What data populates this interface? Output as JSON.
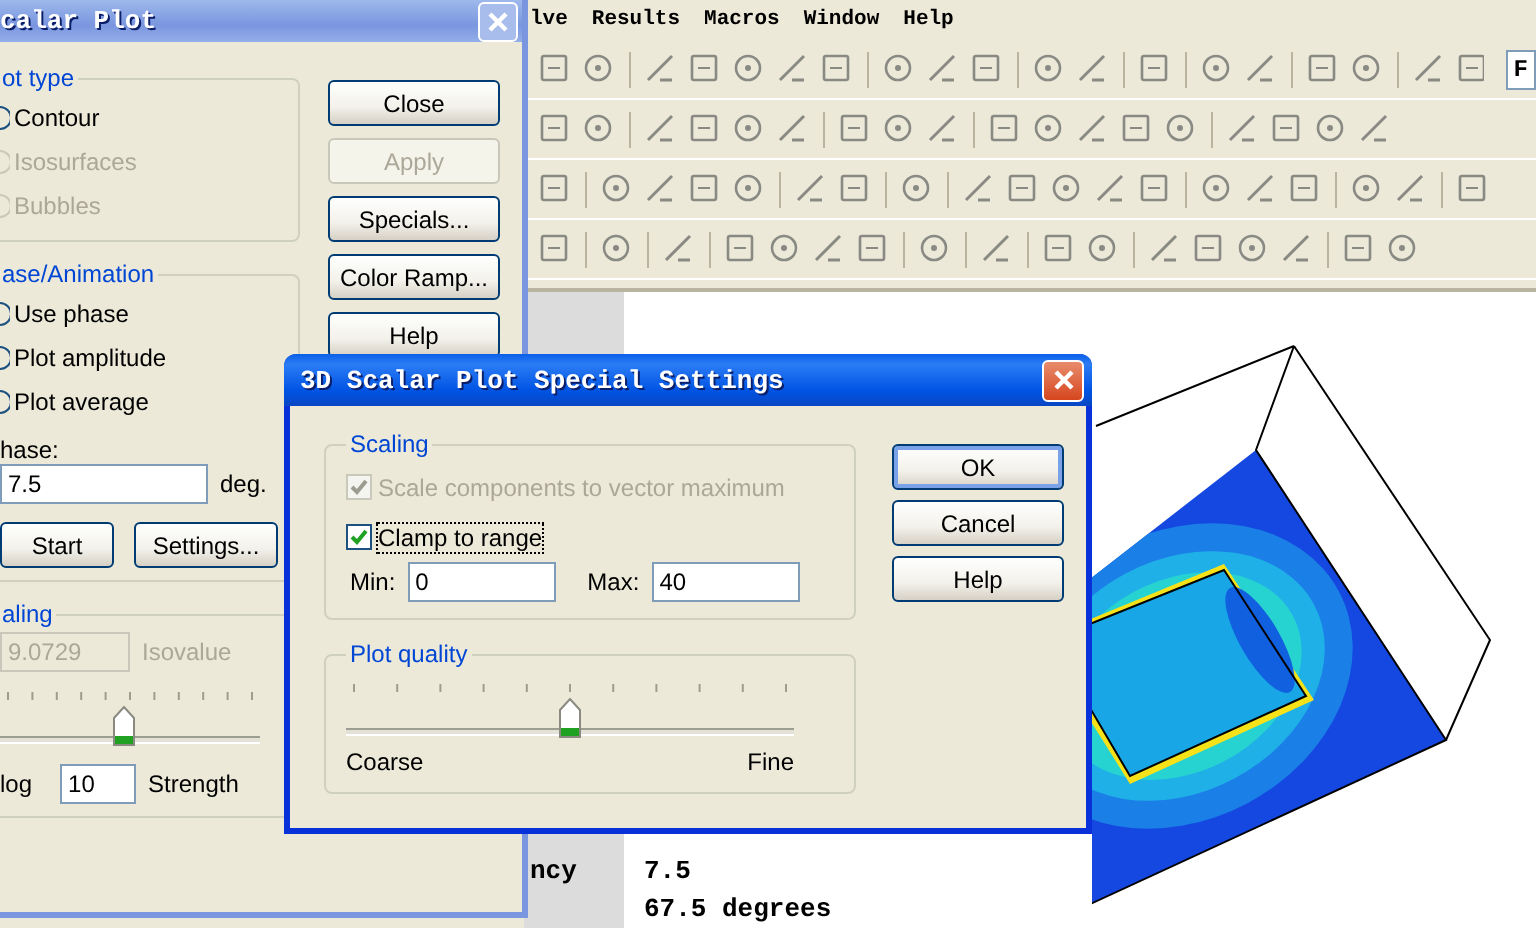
{
  "background_app": {
    "menu": [
      {
        "label": "lve"
      },
      {
        "label": "Results"
      },
      {
        "label": "Macros"
      },
      {
        "label": "Window"
      },
      {
        "label": "Help"
      }
    ],
    "toolbar_field": "F",
    "info_rows": [
      {
        "label": "ncy",
        "value": "7.5"
      },
      {
        "value": "67.5 degrees"
      }
    ]
  },
  "scalar_plot_dialog": {
    "title": "calar Plot",
    "plot_type": {
      "legend": "ot type",
      "options": [
        {
          "label": "Contour",
          "disabled": false
        },
        {
          "label": "Isosurfaces",
          "disabled": true
        },
        {
          "label": "Bubbles",
          "disabled": true
        }
      ]
    },
    "buttons": [
      {
        "label": "Close",
        "disabled": false
      },
      {
        "label": "Apply",
        "disabled": true
      },
      {
        "label": "Specials...",
        "disabled": false
      },
      {
        "label": "Color Ramp...",
        "disabled": false
      },
      {
        "label": "Help",
        "disabled": false
      }
    ],
    "phase_animation": {
      "legend": "ase/Animation",
      "options": [
        {
          "label": "Use phase",
          "disabled": false
        },
        {
          "label": "Plot amplitude",
          "disabled": false
        },
        {
          "label": "Plot average",
          "disabled": false
        }
      ],
      "phase_label": "hase:",
      "phase_value": "7.5",
      "phase_unit": "deg.",
      "buttons": [
        "Start",
        "Settings..."
      ]
    },
    "scaling": {
      "legend": "aling",
      "isovalue": "9.0729",
      "isovalue_disabled": true,
      "isovalue_label": "Isovalue",
      "slider": {
        "level": 0.48
      },
      "log_label": "log",
      "strength_value": "10",
      "strength_label": "Strength"
    }
  },
  "special_settings_dialog": {
    "title": "3D Scalar Plot Special Settings",
    "scaling": {
      "legend": "Scaling",
      "checkboxes": [
        {
          "label": "Scale components to vector maximum",
          "checked": true,
          "disabled": true,
          "focused": false
        },
        {
          "label": "Clamp to range",
          "checked": true,
          "disabled": false,
          "focused": true
        }
      ],
      "min_label": "Min:",
      "min_value": "0",
      "max_label": "Max:",
      "max_value": "40"
    },
    "plot_quality": {
      "legend": "Plot quality",
      "slider": {
        "level": 0.5
      },
      "min_label": "Coarse",
      "max_label": "Fine"
    },
    "buttons": [
      {
        "label": "OK",
        "default": true
      },
      {
        "label": "Cancel",
        "default": false
      },
      {
        "label": "Help",
        "default": false
      }
    ]
  }
}
